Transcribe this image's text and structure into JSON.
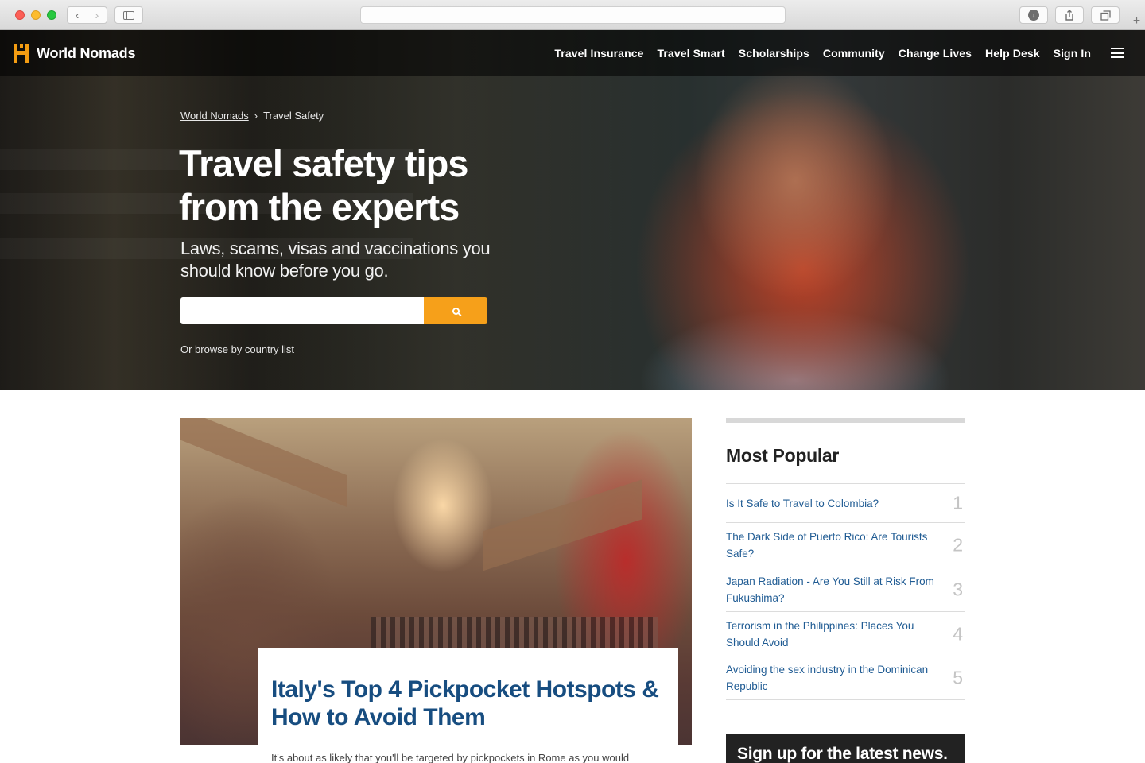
{
  "browser": {
    "url": ""
  },
  "site": {
    "logo_text": "World Nomads",
    "nav": [
      "Travel Insurance",
      "Travel Smart",
      "Scholarships",
      "Community",
      "Change Lives",
      "Help Desk",
      "Sign In"
    ]
  },
  "hero": {
    "breadcrumb": [
      "World Nomads",
      "Travel Safety"
    ],
    "breadcrumb_sep": "›",
    "title_line1": "Travel safety tips",
    "title_line2": "from the experts",
    "subtitle": "Laws, scams, visas and vaccinations you should know before you go.",
    "search_placeholder": "",
    "browse_link": "Or browse by country list"
  },
  "feature": {
    "title": "Italy's Top 4 Pickpocket Hotspots & How to Avoid Them",
    "excerpt": "It's about as likely that you'll be targeted by pickpockets in Rome as you would"
  },
  "sidebar": {
    "title": "Most Popular",
    "items": [
      {
        "label": "Is It Safe to Travel to Colombia?",
        "num": "1"
      },
      {
        "label": "The Dark Side of Puerto Rico: Are Tourists Safe?",
        "num": "2"
      },
      {
        "label": "Japan Radiation - Are You Still at Risk From Fukushima?",
        "num": "3"
      },
      {
        "label": "Terrorism in the Philippines: Places You Should Avoid",
        "num": "4"
      },
      {
        "label": "Avoiding the sex industry in the Dominican Republic",
        "num": "5"
      }
    ],
    "signup": "Sign up for the latest news."
  },
  "colors": {
    "accent": "#f6a01a",
    "link": "#1f5b93",
    "title_blue": "#174d80"
  },
  "icons": [
    "search-icon",
    "hamburger-menu-icon",
    "world-nomads-logo-icon",
    "back-icon",
    "forward-icon",
    "sidebar-icon",
    "download-icon",
    "share-icon",
    "tabs-icon",
    "plus-icon"
  ]
}
